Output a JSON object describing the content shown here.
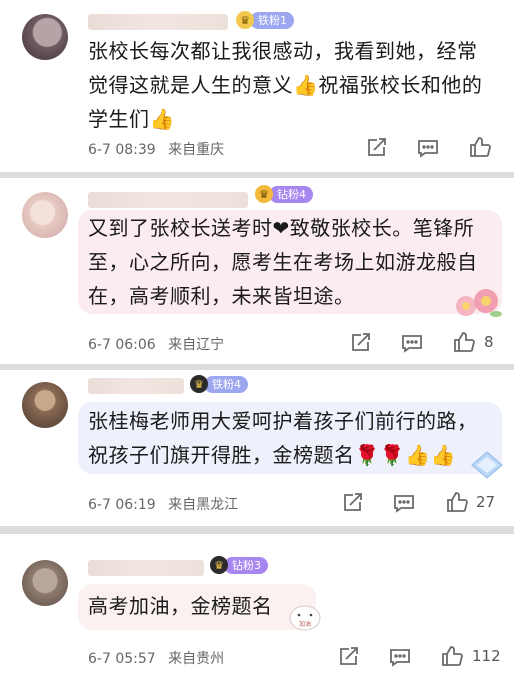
{
  "comments": [
    {
      "badge": "铁粉1",
      "lines": [
        "张校长每次都让我很感动，我看到她，经常",
        "觉得这就是人生的意义👍祝福张校长和他的",
        "学生们👍"
      ],
      "date": "6-7 08:39",
      "location": "来自重庆",
      "likes": ""
    },
    {
      "badge": "钻粉4",
      "lines": [
        "又到了张校长送考时❤致敬张校长。笔锋所",
        "至，心之所向，愿考生在考场上如游龙般自",
        "在，高考顺利，未来皆坦途。"
      ],
      "date": "6-7 06:06",
      "location": "来自辽宁",
      "likes": "8"
    },
    {
      "badge": "铁粉4",
      "lines": [
        "张桂梅老师用大爱呵护着孩子们前行的路，",
        "祝孩子们旗开得胜，金榜题名🌹🌹👍👍"
      ],
      "date": "6-7 06:19",
      "location": "来自黑龙江",
      "likes": "27"
    },
    {
      "badge": "钻粉3",
      "lines": [
        "高考加油，金榜题名"
      ],
      "date": "6-7 05:57",
      "location": "来自贵州",
      "likes": "112"
    }
  ],
  "icons": {
    "share": "share-icon",
    "comment": "comment-icon",
    "like": "like-icon"
  },
  "colors": {
    "tie_badge": "#9da7f0",
    "zuan_badge": "#a786f0",
    "meta_text": "#666666",
    "bubble_pink": "#fbecef",
    "bubble_blue": "#eef1fb"
  },
  "stickers": {
    "bear_text": "加油"
  }
}
